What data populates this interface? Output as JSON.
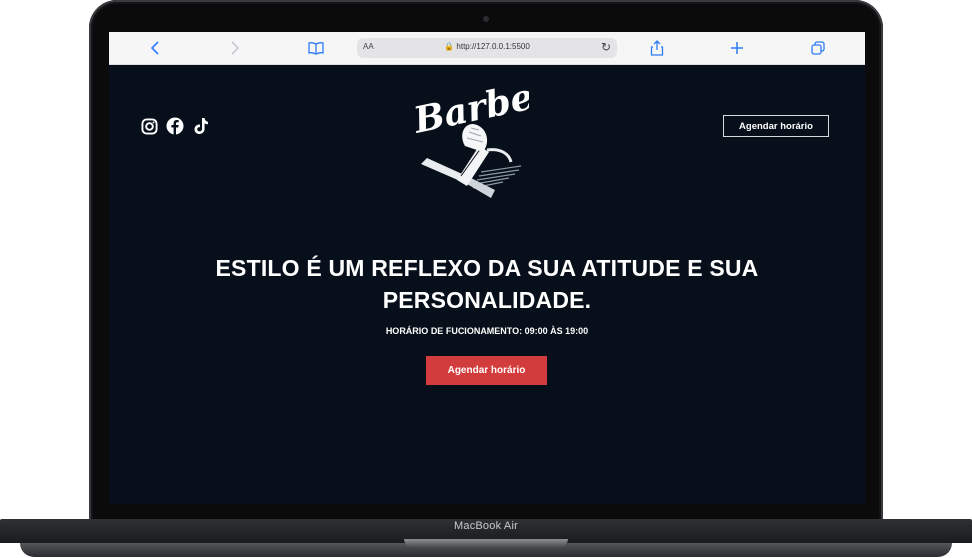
{
  "device": {
    "model_label": "MacBook Air"
  },
  "browser": {
    "aa_label": "AA",
    "url": "http://127.0.0.1:5500"
  },
  "header": {
    "socials": [
      "instagram-icon",
      "facebook-icon",
      "tiktok-icon"
    ],
    "schedule_button_label": "Agendar horário",
    "logo_text": "Barber"
  },
  "hero": {
    "headline_line1": "ESTILO É UM REFLEXO DA SUA ATITUDE E SUA",
    "headline_line2": "PERSONALIDADE.",
    "hours": "HORÁRIO DE FUCIONAMENTO: 09:00 ÀS 19:00",
    "cta_label": "Agendar horário"
  },
  "colors": {
    "page_background": "#07101a",
    "accent": "#d23c3c",
    "browser_accent": "#2d7cf6"
  }
}
